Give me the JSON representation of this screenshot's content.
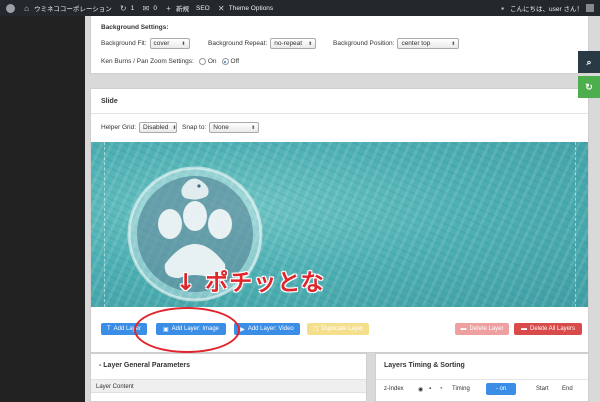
{
  "admin_bar": {
    "site_name": "ウミネココーポレーション",
    "updates_count": "1",
    "comments_count": "0",
    "new_label": "新規",
    "seo_label": "SEO",
    "theme_options_label": "Theme Options",
    "greeting": "こんにちは、user さん！"
  },
  "background_settings": {
    "title": "Background Settings:",
    "fit_label": "Background Fit:",
    "fit_value": "cover",
    "repeat_label": "Background Repeat:",
    "repeat_value": "no-repeat",
    "position_label": "Background Position:",
    "position_value": "center top",
    "kenburns_label": "Ken Burns / Pan Zoom Settings:",
    "on_label": "On",
    "off_label": "Off",
    "kenburns_selected": "Off"
  },
  "slide": {
    "title": "Slide",
    "helper_grid_label": "Helper Grid:",
    "helper_grid_value": "Disabled",
    "snap_label": "Snap to:",
    "snap_value": "None"
  },
  "layer_buttons": {
    "add_layer": "Add Layer",
    "add_layer_image": "Add Layer: Image",
    "add_layer_video": "Add Layer: Video",
    "duplicate_layer": "Duplicate Layer",
    "delete_layer": "Delete Layer",
    "delete_all_layers": "Delete All Layers"
  },
  "annotation": {
    "text": "↓ ポチッとな"
  },
  "layer_params": {
    "title": "-   Layer General Parameters",
    "sub_label": "Layer Content"
  },
  "layers_timing": {
    "title": "Layers Timing & Sorting",
    "zindex_label": "z-Index",
    "timing_label": "Timing",
    "on_label": "- on",
    "start_label": "Start",
    "end_label": "End"
  },
  "colors": {
    "accent_blue": "#3a8ee6",
    "annotation_red": "#e0242c",
    "delete_red": "#d94a4a",
    "admin_bar": "#23282d"
  },
  "icons": [
    "wordpress-logo-icon",
    "home-icon",
    "updates-icon",
    "comments-icon",
    "plus-icon",
    "tools-icon",
    "search-icon",
    "refresh-icon",
    "eye-icon",
    "lock-icon",
    "clock-icon",
    "image-icon"
  ]
}
